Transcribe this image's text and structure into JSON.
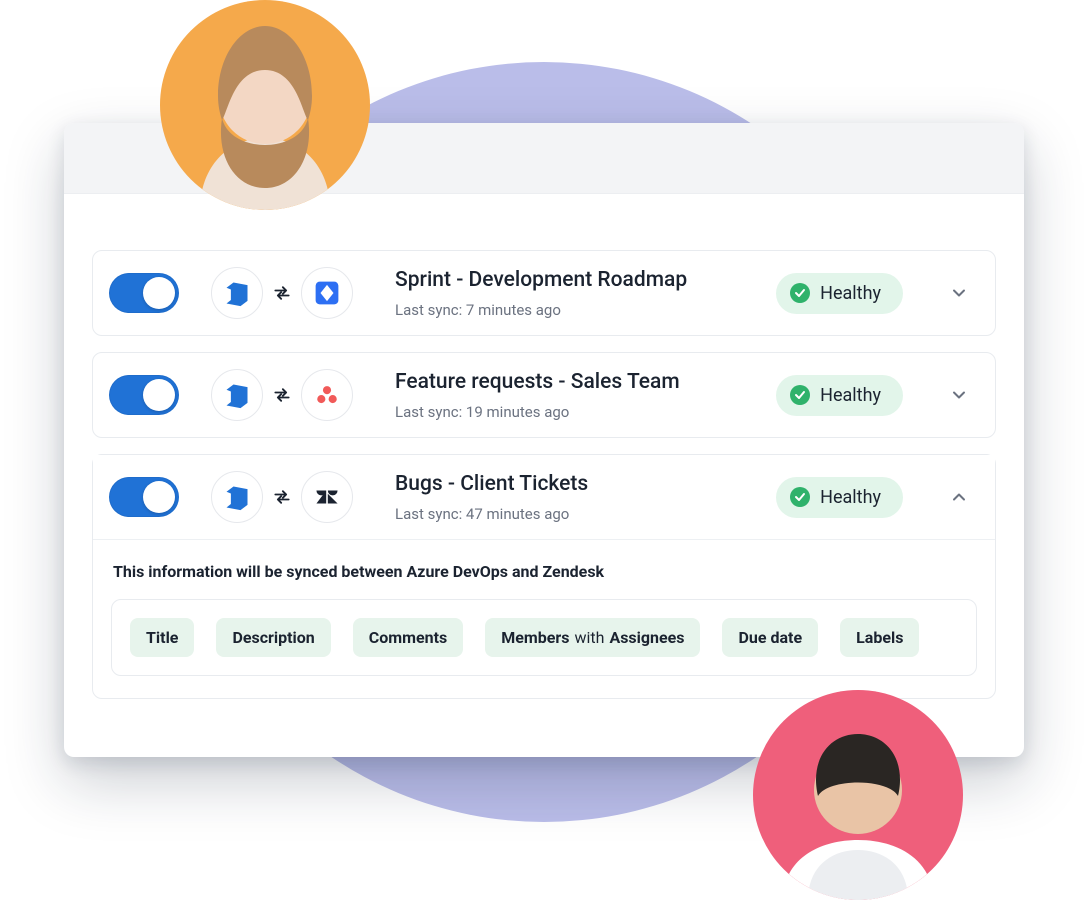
{
  "flows": [
    {
      "title": "Sprint - Development Roadmap",
      "sub": "Last sync: 7 minutes ago",
      "status": "Healthy",
      "source_icon": "azure-devops",
      "target_icon": "jira",
      "enabled": true,
      "expanded": false
    },
    {
      "title": "Feature requests - Sales Team",
      "sub": "Last sync: 19 minutes ago",
      "status": "Healthy",
      "source_icon": "azure-devops",
      "target_icon": "asana",
      "enabled": true,
      "expanded": false
    },
    {
      "title": "Bugs - Client Tickets",
      "sub": "Last sync: 47 minutes ago",
      "status": "Healthy",
      "source_icon": "azure-devops",
      "target_icon": "zendesk",
      "enabled": true,
      "expanded": true
    }
  ],
  "expanded_panel": {
    "description": "This information will be synced between Azure DevOps and Zendesk",
    "chips": [
      {
        "a": "Title"
      },
      {
        "a": "Description"
      },
      {
        "a": "Comments"
      },
      {
        "a": "Members",
        "mid": "with",
        "b": "Assignees"
      },
      {
        "a": "Due date"
      },
      {
        "a": "Labels"
      }
    ]
  },
  "colors": {
    "accent_bg_circle": "#babde9",
    "toggle_on": "#2072d6",
    "healthy_bg": "#e2f5ea",
    "healthy_check": "#2fb26b",
    "avatar_top_bg": "#f5a94b",
    "avatar_bot_bg": "#ef5f7b"
  }
}
